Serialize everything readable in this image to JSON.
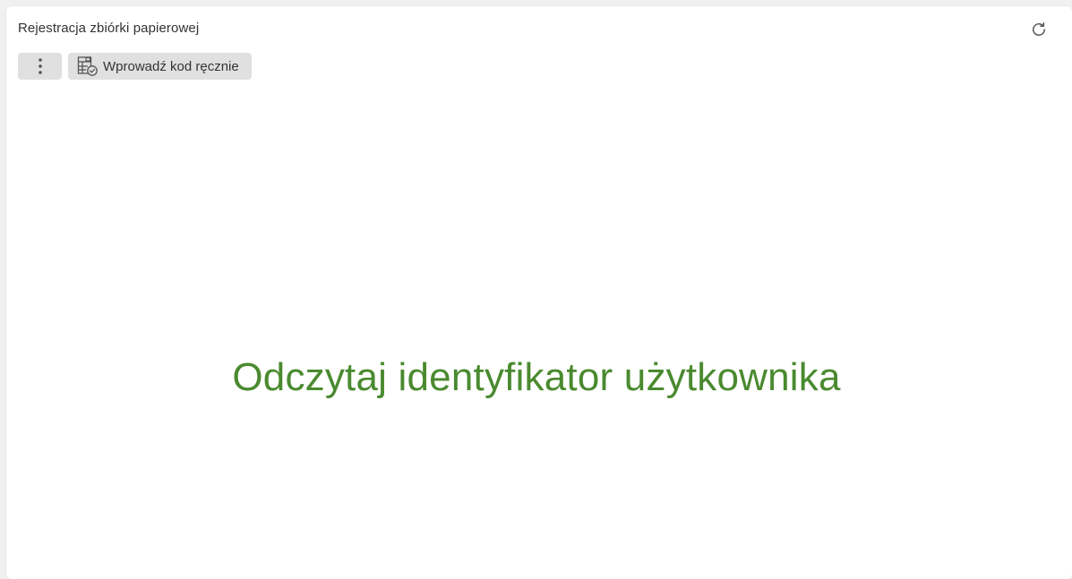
{
  "panel": {
    "title": "Rejestracja zbiórki papierowej"
  },
  "toolbar": {
    "more_icon": "vertical-dots-icon",
    "manual_button_icon": "table-check-icon",
    "manual_button_label": "Wprowadź kod ręcznie",
    "refresh_icon": "refresh-icon"
  },
  "main": {
    "message": "Odczytaj identyfikator użytkownika"
  },
  "colors": {
    "accent_green": "#4a8a2f",
    "button_bg": "#e0e0e0",
    "panel_bg": "#ffffff",
    "page_bg": "#f0f0f0"
  }
}
